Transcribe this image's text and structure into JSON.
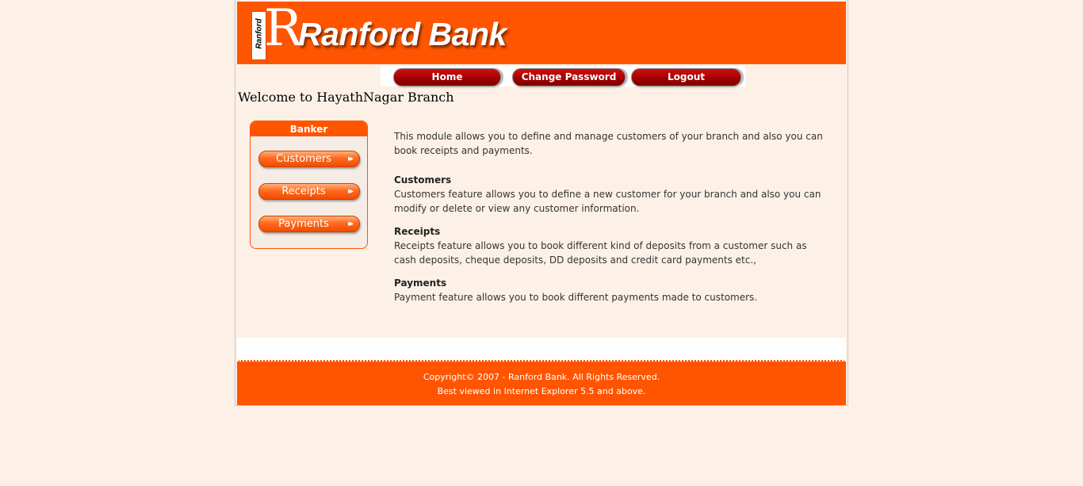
{
  "header": {
    "logo_text": "Ranford",
    "logo_letter": "R",
    "brand": "Ranford Bank",
    "colors": {
      "primary": "#ff5500",
      "nav_button": "#b00000",
      "background": "#fdf1e7"
    }
  },
  "nav": {
    "home": "Home",
    "change_password": "Change Password",
    "logout": "Logout"
  },
  "welcome": "Welcome to HayathNagar Branch",
  "sidebar": {
    "title": "Banker",
    "items": [
      {
        "label": "Customers",
        "icon": "double-chevron-right-icon"
      },
      {
        "label": "Receipts",
        "icon": "double-chevron-right-icon"
      },
      {
        "label": "Payments",
        "icon": "double-chevron-right-icon"
      }
    ]
  },
  "content": {
    "intro": "This module allows you to define and manage customers of your branch and also you can book receipts and payments.",
    "sections": [
      {
        "title": "Customers",
        "text": "Customers feature allows you to define a new customer for your branch and also you can modify or delete or view any customer information."
      },
      {
        "title": "Receipts",
        "text": "Receipts feature allows you to book different kind of deposits from a customer such as cash deposits, cheque deposits, DD deposits and credit card payments etc.,"
      },
      {
        "title": "Payments",
        "text": "Payment feature allows you to book different payments made to customers."
      }
    ]
  },
  "footer": {
    "copyright": "Copyright© 2007 - Ranford Bank. All Rights Reserved.",
    "note": "Best viewed in Internet Explorer 5.5 and above."
  }
}
